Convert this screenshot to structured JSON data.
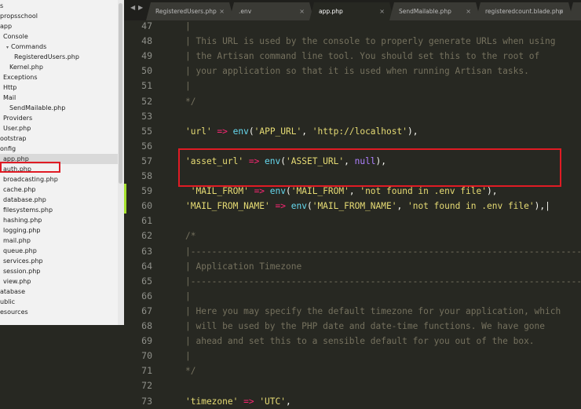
{
  "sidebar": {
    "items": [
      {
        "label": "s",
        "indent": 0,
        "arrow": ""
      },
      {
        "label": "propsschool",
        "indent": 0,
        "arrow": ""
      },
      {
        "label": "app",
        "indent": 0,
        "arrow": ""
      },
      {
        "label": "Console",
        "indent": 4,
        "arrow": ""
      },
      {
        "label": "Commands",
        "indent": 8,
        "arrow": "▾"
      },
      {
        "label": "RegisteredUsers.php",
        "indent": 18,
        "arrow": ""
      },
      {
        "label": "Kernel.php",
        "indent": 12,
        "arrow": ""
      },
      {
        "label": "Exceptions",
        "indent": 4,
        "arrow": ""
      },
      {
        "label": "Http",
        "indent": 4,
        "arrow": ""
      },
      {
        "label": "Mail",
        "indent": 4,
        "arrow": ""
      },
      {
        "label": "SendMailable.php",
        "indent": 12,
        "arrow": ""
      },
      {
        "label": "Providers",
        "indent": 4,
        "arrow": ""
      },
      {
        "label": "User.php",
        "indent": 4,
        "arrow": ""
      },
      {
        "label": "ootstrap",
        "indent": 0,
        "arrow": ""
      },
      {
        "label": "onfig",
        "indent": 0,
        "arrow": ""
      },
      {
        "label": "app.php",
        "indent": 4,
        "arrow": ""
      },
      {
        "label": "auth.php",
        "indent": 4,
        "arrow": ""
      },
      {
        "label": "broadcasting.php",
        "indent": 4,
        "arrow": ""
      },
      {
        "label": "cache.php",
        "indent": 4,
        "arrow": ""
      },
      {
        "label": "database.php",
        "indent": 4,
        "arrow": ""
      },
      {
        "label": "filesystems.php",
        "indent": 4,
        "arrow": ""
      },
      {
        "label": "hashing.php",
        "indent": 4,
        "arrow": ""
      },
      {
        "label": "logging.php",
        "indent": 4,
        "arrow": ""
      },
      {
        "label": "mail.php",
        "indent": 4,
        "arrow": ""
      },
      {
        "label": "queue.php",
        "indent": 4,
        "arrow": ""
      },
      {
        "label": "services.php",
        "indent": 4,
        "arrow": ""
      },
      {
        "label": "session.php",
        "indent": 4,
        "arrow": ""
      },
      {
        "label": "view.php",
        "indent": 4,
        "arrow": ""
      },
      {
        "label": "atabase",
        "indent": 0,
        "arrow": ""
      },
      {
        "label": "ublic",
        "indent": 0,
        "arrow": ""
      },
      {
        "label": "esources",
        "indent": 0,
        "arrow": ""
      }
    ],
    "selected": "app.php"
  },
  "tabs": [
    {
      "label": "RegisteredUsers.php",
      "active": false
    },
    {
      "label": ".env",
      "active": false
    },
    {
      "label": "app.php",
      "active": true
    },
    {
      "label": "SendMailable.php",
      "active": false
    },
    {
      "label": "registeredcount.blade.php",
      "active": false
    },
    {
      "label": "",
      "active": false
    }
  ],
  "tab_nav": {
    "prev": "◀",
    "next": "▶"
  },
  "tab_close_glyph": "×",
  "lines": [
    {
      "n": "47",
      "segs": [
        [
          "c-com",
          "|"
        ]
      ]
    },
    {
      "n": "48",
      "segs": [
        [
          "c-com",
          "| This URL is used by the console to properly generate URLs when using"
        ]
      ]
    },
    {
      "n": "49",
      "segs": [
        [
          "c-com",
          "| the Artisan command line tool. You should set this to the root of"
        ]
      ]
    },
    {
      "n": "50",
      "segs": [
        [
          "c-com",
          "| your application so that it is used when running Artisan tasks."
        ]
      ]
    },
    {
      "n": "51",
      "segs": [
        [
          "c-com",
          "|"
        ]
      ]
    },
    {
      "n": "52",
      "segs": [
        [
          "c-com",
          "*/"
        ]
      ]
    },
    {
      "n": "53",
      "segs": []
    },
    {
      "n": "55",
      "segs": [
        [
          "c-str",
          "'url'"
        ],
        [
          "c-op",
          " => "
        ],
        [
          "c-fn",
          "env"
        ],
        [
          "",
          "("
        ],
        [
          "c-str",
          "'APP_URL'"
        ],
        [
          "",
          ", "
        ],
        [
          "c-str",
          "'http://localhost'"
        ],
        [
          "",
          "),"
        ]
      ]
    },
    {
      "n": "56",
      "segs": []
    },
    {
      "n": "57",
      "segs": [
        [
          "c-str",
          "'asset_url'"
        ],
        [
          "c-op",
          " => "
        ],
        [
          "c-fn",
          "env"
        ],
        [
          "",
          "("
        ],
        [
          "c-str",
          "'ASSET_URL'"
        ],
        [
          "",
          ", "
        ],
        [
          "c-kw",
          "null"
        ],
        [
          "",
          "),"
        ]
      ]
    },
    {
      "n": "58",
      "segs": []
    },
    {
      "n": "59",
      "segs": [
        [
          "c-str",
          " 'MAIL_FROM'"
        ],
        [
          "c-op",
          " => "
        ],
        [
          "c-fn",
          "env"
        ],
        [
          "",
          "("
        ],
        [
          "c-str",
          "'MAIL_FROM'"
        ],
        [
          "",
          ", "
        ],
        [
          "c-str",
          "'not found in .env file'"
        ],
        [
          "",
          "),"
        ]
      ]
    },
    {
      "n": "60",
      "segs": [
        [
          "c-str",
          "'MAIL_FROM_NAME'"
        ],
        [
          "c-op",
          " => "
        ],
        [
          "c-fn",
          "env"
        ],
        [
          "",
          "("
        ],
        [
          "c-str",
          "'MAIL_FROM_NAME'"
        ],
        [
          "",
          ", "
        ],
        [
          "c-str",
          "'not found in .env file'"
        ],
        [
          "",
          "),|"
        ]
      ]
    },
    {
      "n": "61",
      "segs": []
    },
    {
      "n": "62",
      "segs": [
        [
          "c-com",
          "/*"
        ]
      ]
    },
    {
      "n": "63",
      "segs": [
        [
          "c-com",
          "|--------------------------------------------------------------------------"
        ]
      ]
    },
    {
      "n": "64",
      "segs": [
        [
          "c-com",
          "| Application Timezone"
        ]
      ]
    },
    {
      "n": "65",
      "segs": [
        [
          "c-com",
          "|--------------------------------------------------------------------------"
        ]
      ]
    },
    {
      "n": "66",
      "segs": [
        [
          "c-com",
          "|"
        ]
      ]
    },
    {
      "n": "67",
      "segs": [
        [
          "c-com",
          "| Here you may specify the default timezone for your application, which"
        ]
      ]
    },
    {
      "n": "68",
      "segs": [
        [
          "c-com",
          "| will be used by the PHP date and date-time functions. We have gone"
        ]
      ]
    },
    {
      "n": "69",
      "segs": [
        [
          "c-com",
          "| ahead and set this to a sensible default for you out of the box."
        ]
      ]
    },
    {
      "n": "70",
      "segs": [
        [
          "c-com",
          "|"
        ]
      ]
    },
    {
      "n": "71",
      "segs": [
        [
          "c-com",
          "*/"
        ]
      ]
    },
    {
      "n": "72",
      "segs": []
    },
    {
      "n": "73",
      "segs": [
        [
          "c-str",
          "'timezone'"
        ],
        [
          "c-op",
          " => "
        ],
        [
          "c-str",
          "'UTC'"
        ],
        [
          "",
          ","
        ]
      ]
    }
  ]
}
